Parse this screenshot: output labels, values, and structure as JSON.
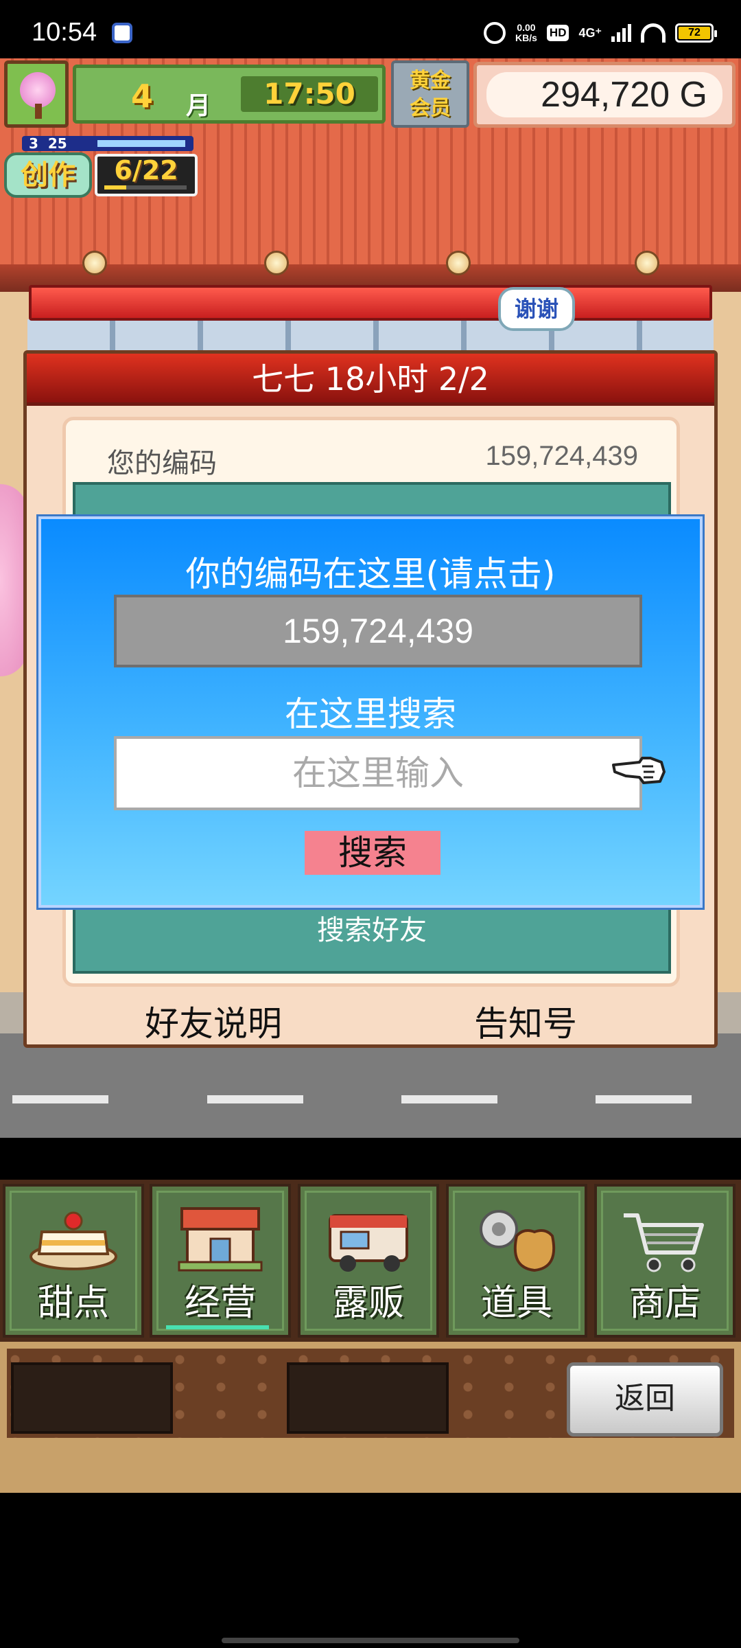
{
  "status_bar": {
    "time": "10:54",
    "speed_top": "0.00",
    "speed_bottom": "KB/s",
    "hd": "HD",
    "network": "4G⁺",
    "battery": "72"
  },
  "hud": {
    "month_number": "4",
    "month_unit": "月",
    "clock": "17:50",
    "member_line1": "黄金",
    "member_line2": "会员",
    "gold": "294,720 G",
    "create_top_left": "3",
    "create_top_right": "25",
    "create_label": "创作",
    "create_count": "6/22",
    "create_progress": 0.27
  },
  "thanks_bubble": "谢谢",
  "panel": {
    "title": "七七  18小时 2/2",
    "code_label": "您的编码",
    "code_value": "159,724,439",
    "teal_top_text": "搜索好友",
    "teal_bottom_text": "搜索好友",
    "footer_left": "好友说明",
    "footer_right": "告知号"
  },
  "dialog": {
    "title": "你的编码在这里(请点击)",
    "code": "159,724,439",
    "search_title": "在这里搜索",
    "input_placeholder": "在这里输入",
    "search_button": "搜索"
  },
  "nav": {
    "items": [
      {
        "label": "甜点",
        "icon": "cake-icon"
      },
      {
        "label": "经营",
        "icon": "shop-icon",
        "active": true
      },
      {
        "label": "露贩",
        "icon": "food-truck-icon"
      },
      {
        "label": "道具",
        "icon": "items-bag-icon"
      },
      {
        "label": "商店",
        "icon": "shopping-cart-icon"
      }
    ],
    "back_label": "返回"
  },
  "colors": {
    "dialog_top": "#0a8bff",
    "dialog_bottom": "#74d4ff",
    "search_button": "#f5828f",
    "panel_header": "#c81f1f",
    "teal": "#4fa397"
  }
}
